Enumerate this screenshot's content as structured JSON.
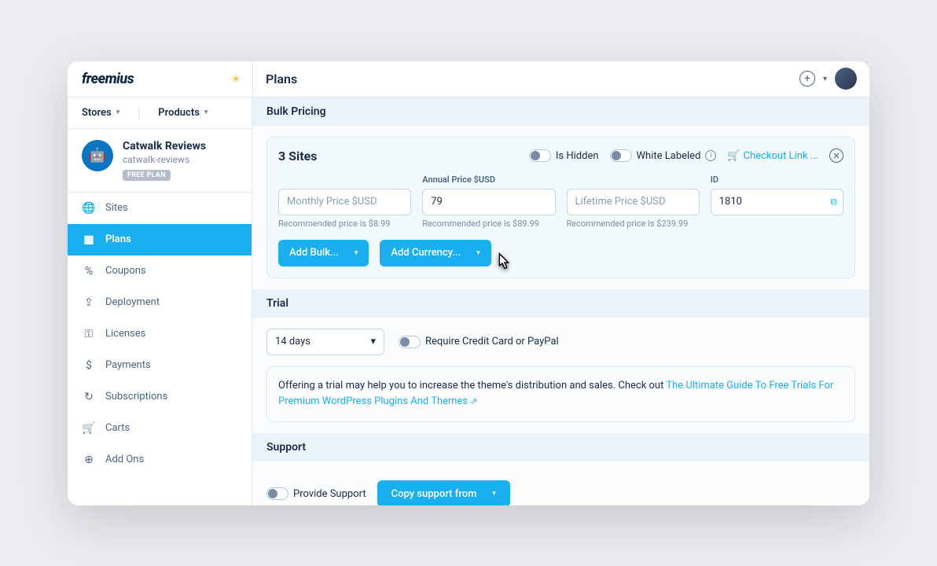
{
  "brand": "freemius",
  "page_title": "Plans",
  "side_tabs": {
    "stores": "Stores",
    "products": "Products"
  },
  "product": {
    "name": "Catwalk Reviews",
    "slug": "catwalk-reviews",
    "badge": "FREE PLAN"
  },
  "nav": [
    {
      "label": "Sites"
    },
    {
      "label": "Plans"
    },
    {
      "label": "Coupons"
    },
    {
      "label": "Deployment"
    },
    {
      "label": "Licenses"
    },
    {
      "label": "Payments"
    },
    {
      "label": "Subscriptions"
    },
    {
      "label": "Carts"
    },
    {
      "label": "Add Ons"
    }
  ],
  "bulk_pricing_header": "Bulk Pricing",
  "pricing": {
    "title": "3 Sites",
    "is_hidden_label": "Is Hidden",
    "white_labeled_label": "White Labeled",
    "checkout_link": "Checkout Link ...",
    "monthly": {
      "placeholder": "Monthly Price $USD",
      "hint": "Recommended price is $8.99"
    },
    "annual": {
      "label": "Annual Price $USD",
      "value": "79",
      "hint": "Recommended price is $89.99"
    },
    "lifetime": {
      "placeholder": "Lifetime Price $USD",
      "hint": "Recommended price is $239.99"
    },
    "id": {
      "label": "ID",
      "value": "1810"
    },
    "add_bulk": "Add Bulk...",
    "add_currency": "Add Currency..."
  },
  "trial": {
    "header": "Trial",
    "period": "14 days",
    "require_cc": "Require Credit Card or PayPal",
    "info_text": "Offering a trial may help you to increase the theme's distribution and sales. Check out",
    "info_link": "The Ultimate Guide To Free Trials For Premium WordPress Plugins And Themes"
  },
  "support": {
    "header": "Support",
    "provide_label": "Provide Support",
    "copy_from": "Copy support from"
  }
}
